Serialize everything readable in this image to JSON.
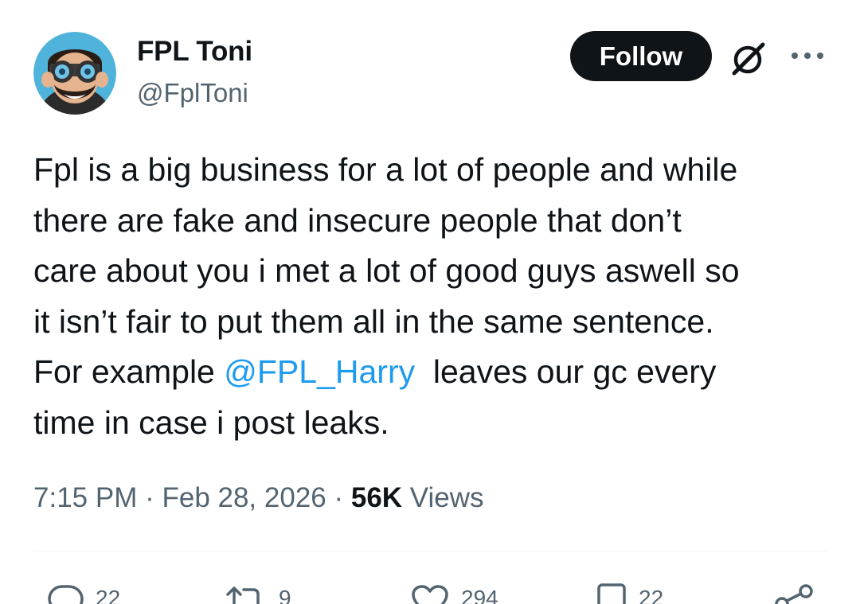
{
  "author": {
    "name": "FPL Toni",
    "handle": "@FplToni"
  },
  "follow_label": "Follow",
  "tweet": {
    "lines": [
      "Fpl is a big business for a lot of people and while",
      "there are fake and insecure people that don’t",
      "care about you i met a lot of good guys aswell so",
      "it isn’t fair to put them all in the same sentence."
    ],
    "line5_before": "For example ",
    "mention": "@FPL_Harry",
    "line5_after": "  leaves our gc every",
    "line6": "time in case i post leaks."
  },
  "meta": {
    "time": "7:15 PM",
    "separator": " · ",
    "date": "Feb 28, 2026",
    "views_count": "56K",
    "views_label": " Views"
  },
  "actions": {
    "replies": "22",
    "reposts": "9",
    "likes": "294",
    "bookmarks": "22"
  },
  "icons": {
    "avatar": "avatar-binoculars-cartoon",
    "grok": "grok-icon",
    "more": "more-horizontal-icon",
    "reply": "reply-icon",
    "repost": "repost-icon",
    "like": "heart-icon",
    "bookmark": "bookmark-icon",
    "share": "share-icon"
  },
  "colors": {
    "text": "#0f1419",
    "secondary": "#536471",
    "link": "#1d9bf0",
    "follow_bg": "#0f1419",
    "follow_text": "#ffffff",
    "divider": "#eff3f4"
  }
}
